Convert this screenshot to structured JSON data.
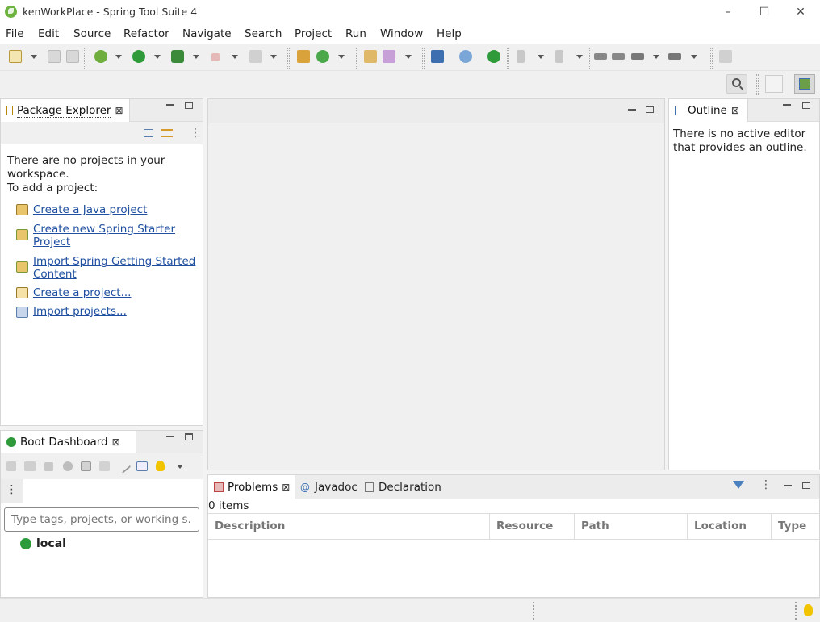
{
  "window": {
    "title": "kenWorkPlace - Spring Tool Suite 4",
    "controls": {
      "minimize": "–",
      "maximize": "☐",
      "close": "✕"
    }
  },
  "menu": [
    "File",
    "Edit",
    "Source",
    "Refactor",
    "Navigate",
    "Search",
    "Project",
    "Run",
    "Window",
    "Help"
  ],
  "toolbar_icons": [
    "new-icon",
    "save-icon",
    "save-all-icon",
    "debug-icon",
    "run-icon",
    "run-external-icon",
    "stop-icon",
    "build-icon",
    "new-java-package-icon",
    "new-class-icon",
    "open-type-icon",
    "open-task-icon",
    "console-icon",
    "search-icon",
    "boot-icon",
    "next-annotation-icon",
    "prev-annotation-icon",
    "last-edit-icon",
    "back-icon",
    "forward-icon",
    "pin-icon"
  ],
  "package_explorer": {
    "tab": "Package Explorer",
    "message": [
      "There are no projects in your",
      "workspace.",
      "To add a project:"
    ],
    "links": [
      {
        "lines": [
          "Create a Java project"
        ],
        "icon": "java-project-icon"
      },
      {
        "lines": [
          "Create new Spring Starter",
          "Project"
        ],
        "icon": "spring-starter-icon"
      },
      {
        "lines": [
          "Import Spring Getting Started",
          "Content"
        ],
        "icon": "spring-guide-icon"
      },
      {
        "lines": [
          "Create a project..."
        ],
        "icon": "new-project-icon"
      },
      {
        "lines": [
          "Import projects..."
        ],
        "icon": "import-icon"
      }
    ]
  },
  "outline": {
    "tab": "Outline",
    "message": [
      "There is no active editor",
      "that provides an outline."
    ]
  },
  "boot_dashboard": {
    "tab": "Boot Dashboard",
    "filter_placeholder": "Type tags, projects, or working s...",
    "nodes": [
      "local"
    ]
  },
  "problems": {
    "tabs": [
      "Problems",
      "Javadoc",
      "Declaration"
    ],
    "count": "0 items",
    "columns": [
      "Description",
      "Resource",
      "Path",
      "Location",
      "Type"
    ]
  },
  "colors": {
    "accent_green": "#6db33f",
    "link": "#1f4fa0"
  }
}
